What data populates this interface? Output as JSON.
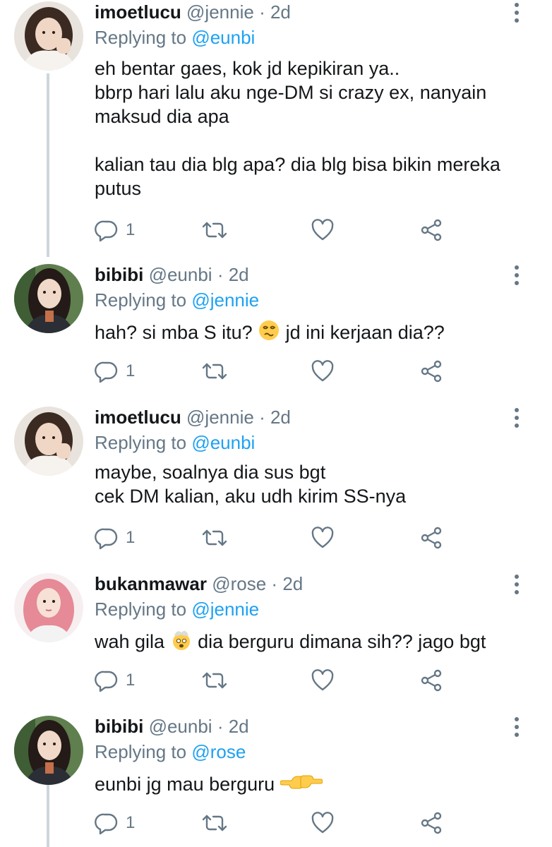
{
  "tweets": [
    {
      "name": "imoetlucu",
      "handle": "@jennie",
      "separator": "·",
      "time": "2d",
      "replying_prefix": "Replying to",
      "replying_to": "@eunbi",
      "text": "eh bentar gaes, kok jd kepikiran ya..\nbbrp hari lalu aku nge-DM si crazy ex, nanyain maksud dia apa\n\nkalian tau dia blg apa? dia blg bisa bikin mereka putus",
      "reply_count": "1",
      "avatar": "brunette-woman-white-sweater"
    },
    {
      "name": "bibibi",
      "handle": "@eunbi",
      "separator": "·",
      "time": "2d",
      "replying_prefix": "Replying to",
      "replying_to": "@jennie",
      "text_before": "hah? si mba S itu? ",
      "emoji": "woozy-face-emoji",
      "text_after": " jd ini kerjaan dia??",
      "reply_count": "1",
      "avatar": "long-dark-hair-woman-green-background"
    },
    {
      "name": "imoetlucu",
      "handle": "@jennie",
      "separator": "·",
      "time": "2d",
      "replying_prefix": "Replying to",
      "replying_to": "@eunbi",
      "text": "maybe, soalnya dia sus bgt\ncek DM kalian, aku udh kirim SS-nya",
      "reply_count": "1",
      "avatar": "brunette-woman-white-sweater"
    },
    {
      "name": "bukanmawar",
      "handle": "@rose",
      "separator": "·",
      "time": "2d",
      "replying_prefix": "Replying to",
      "replying_to": "@jennie",
      "text_before": "wah gila ",
      "emoji": "exploding-head-emoji",
      "text_after": " dia berguru dimana sih?? jago bgt",
      "reply_count": "1",
      "avatar": "pink-hair-woman"
    },
    {
      "name": "bibibi",
      "handle": "@eunbi",
      "separator": "·",
      "time": "2d",
      "replying_prefix": "Replying to",
      "replying_to": "@rose",
      "text_before": "eunbi jg mau berguru ",
      "emoji": "pointing-fingers-emoji",
      "text_after": "",
      "reply_count": "1",
      "avatar": "long-dark-hair-woman-green-background"
    }
  ],
  "colors": {
    "text": "#14171a",
    "secondary": "#657786",
    "accent": "#1da1f2",
    "thread": "#ccd6dd"
  },
  "icons": [
    "reply-icon",
    "retweet-icon",
    "like-icon",
    "share-icon",
    "more-options-icon"
  ]
}
